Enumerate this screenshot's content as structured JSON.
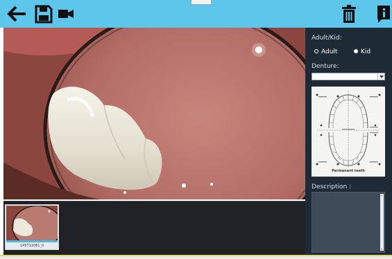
{
  "toolbar": {
    "icons": [
      "back-arrow-icon",
      "save-icon",
      "video-camera-icon",
      "trash-icon",
      "info-icon"
    ],
    "background": "#5ec6ea"
  },
  "top_tab": {
    "text": ""
  },
  "thumbnail": {
    "label": "145711061_0"
  },
  "panel": {
    "adult_kid_label": "Adult/Kid:",
    "adult_label": "Adult",
    "kid_label": "Kid",
    "selected": "Kid",
    "denture_label": "Denture:",
    "denture_value": "",
    "chart_caption": "Permanent teeth",
    "description_label": "Description :",
    "description_value": "",
    "background": "#1e2a36"
  }
}
